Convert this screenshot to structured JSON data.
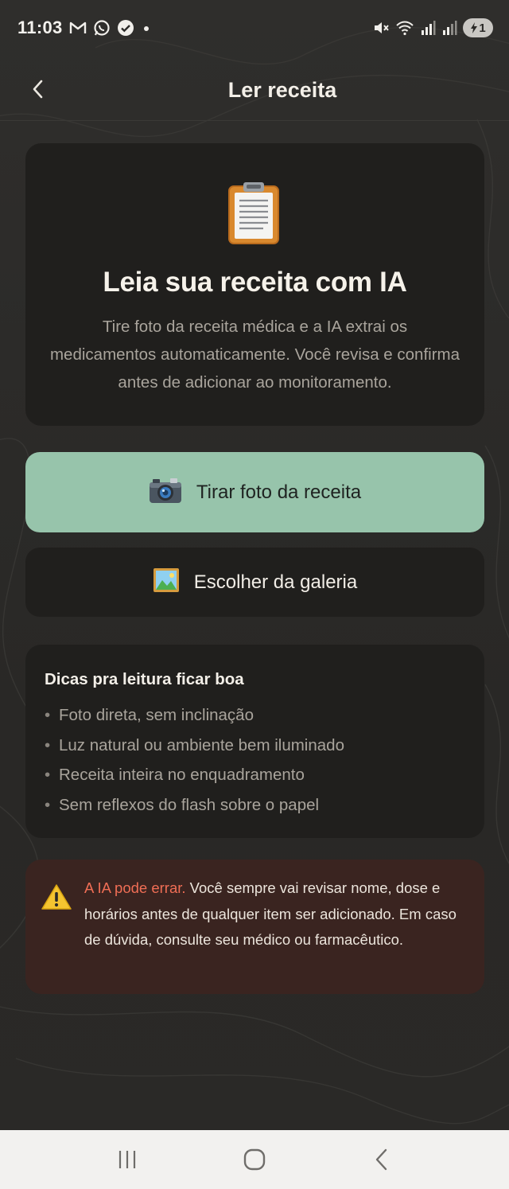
{
  "status_bar": {
    "time": "11:03",
    "battery_level": "1",
    "icons": [
      "gmail-icon",
      "whatsapp-icon",
      "check-badge-icon",
      "dot-icon",
      "mute-icon",
      "wifi-icon",
      "signal-icon",
      "signal-icon-2",
      "battery-icon"
    ]
  },
  "header": {
    "title": "Ler receita",
    "back_icon": "chevron-left-icon"
  },
  "intro": {
    "icon": "clipboard-icon",
    "title": "Leia sua receita com IA",
    "description": "Tire foto da receita médica e a IA extrai os medicamentos automaticamente. Você revisa e confirma antes de adicionar ao monitoramento."
  },
  "actions": {
    "camera_label": "Tirar foto da receita",
    "camera_icon": "camera-icon",
    "gallery_label": "Escolher da galeria",
    "gallery_icon": "picture-icon"
  },
  "tips": {
    "title": "Dicas pra leitura ficar boa",
    "items": [
      "Foto direta, sem inclinação",
      "Luz natural ou ambiente bem iluminado",
      "Receita inteira no enquadramento",
      "Sem reflexos do flash sobre o papel"
    ]
  },
  "warning": {
    "icon": "warning-icon",
    "strong": "A IA pode errar.",
    "text": " Você sempre vai revisar nome, dose e horários antes de qualquer item ser adicionado. Em caso de dúvida, consulte seu médico ou farmacêutico."
  },
  "colors": {
    "background": "#2b2a28",
    "card": "#201f1d",
    "primary_button": "#97c4ab",
    "warning_card": "#3a2420",
    "warning_accent": "#f06e55"
  },
  "nav_bar": {
    "icons": [
      "recent-apps-icon",
      "home-icon",
      "back-icon"
    ]
  }
}
